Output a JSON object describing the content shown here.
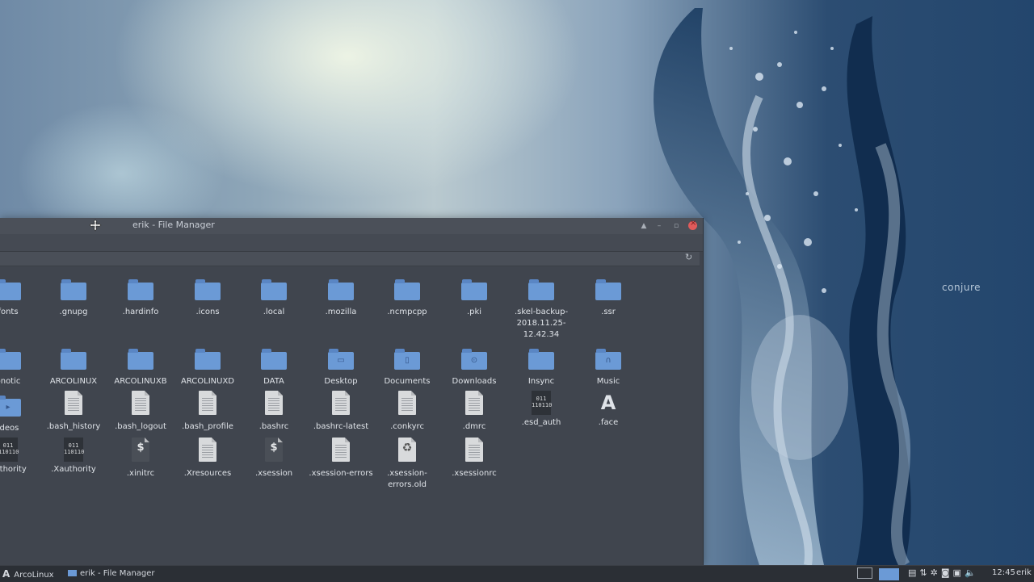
{
  "window": {
    "title": "erik - File Manager",
    "items_row1": [
      {
        "label": "fonts",
        "kind": "folder"
      },
      {
        "label": ".gnupg",
        "kind": "folder"
      },
      {
        "label": ".hardinfo",
        "kind": "folder"
      },
      {
        "label": ".icons",
        "kind": "folder"
      },
      {
        "label": ".local",
        "kind": "folder"
      },
      {
        "label": ".mozilla",
        "kind": "folder"
      },
      {
        "label": ".ncmpcpp",
        "kind": "folder"
      },
      {
        "label": ".pki",
        "kind": "folder"
      },
      {
        "label": ".skel-backup-2018.11.25-12.42.34",
        "kind": "folder"
      },
      {
        "label": ".ssr",
        "kind": "folder"
      }
    ],
    "items_row2": [
      {
        "label": "onotic",
        "kind": "folder"
      },
      {
        "label": "ARCOLINUX",
        "kind": "folder"
      },
      {
        "label": "ARCOLINUXB",
        "kind": "folder"
      },
      {
        "label": "ARCOLINUXD",
        "kind": "folder"
      },
      {
        "label": "DATA",
        "kind": "folder"
      },
      {
        "label": "Desktop",
        "kind": "folder-desktop"
      },
      {
        "label": "Documents",
        "kind": "folder-documents"
      },
      {
        "label": "Downloads",
        "kind": "folder-downloads"
      },
      {
        "label": "Insync",
        "kind": "folder"
      },
      {
        "label": "Music",
        "kind": "folder-music"
      }
    ],
    "items_row3": [
      {
        "label": "ideos",
        "kind": "folder-videos"
      },
      {
        "label": ".bash_history",
        "kind": "text"
      },
      {
        "label": ".bash_logout",
        "kind": "text"
      },
      {
        "label": ".bash_profile",
        "kind": "text"
      },
      {
        "label": ".bashrc",
        "kind": "text"
      },
      {
        "label": ".bashrc-latest",
        "kind": "text"
      },
      {
        "label": ".conkyrc",
        "kind": "text"
      },
      {
        "label": ".dmrc",
        "kind": "text"
      },
      {
        "label": ".esd_auth",
        "kind": "binary"
      },
      {
        "label": ".face",
        "kind": "image"
      }
    ],
    "items_row4": [
      {
        "label": "authority",
        "kind": "binary"
      },
      {
        "label": ".Xauthority",
        "kind": "binary"
      },
      {
        "label": ".xinitrc",
        "kind": "script"
      },
      {
        "label": ".Xresources",
        "kind": "text"
      },
      {
        "label": ".xsession",
        "kind": "script"
      },
      {
        "label": ".xsession-errors",
        "kind": "text"
      },
      {
        "label": ".xsession-errors.old",
        "kind": "trash"
      },
      {
        "label": ".xsessionrc",
        "kind": "text"
      }
    ]
  },
  "wallpaper": {
    "brand": "conjure"
  },
  "taskbar": {
    "menu_label": "ArcoLinux",
    "task_label": "erik - File Manager",
    "clock": "12:45",
    "user": "erik"
  },
  "colors": {
    "folder": "#6b9ad6",
    "close": "#e05b5b",
    "panel": "#2b2f35"
  }
}
